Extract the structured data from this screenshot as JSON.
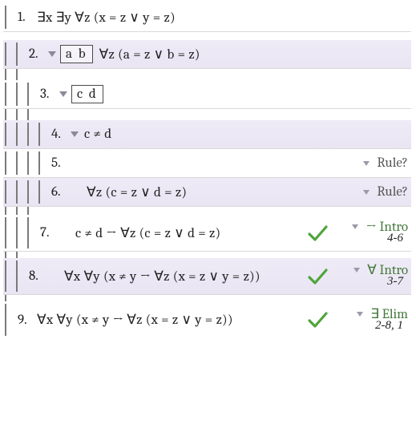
{
  "lines": {
    "l1": {
      "num": "1.",
      "formula": "∃x ∃y ∀z (x = z ∨ y = z)"
    },
    "l2": {
      "num": "2.",
      "flag": "a b",
      "formula": "∀z (a = z ∨ b = z)"
    },
    "l3": {
      "num": "3.",
      "flag": "c d",
      "formula": ""
    },
    "l4": {
      "num": "4.",
      "formula": "c ≠ d"
    },
    "l5": {
      "num": "5.",
      "formula": "",
      "rule": "Rule?"
    },
    "l6": {
      "num": "6.",
      "formula": "∀z (c = z ∨ d = z)",
      "rule": "Rule?"
    },
    "l7": {
      "num": "7.",
      "formula": "c ≠ d → ∀z (c = z ∨ d = z)",
      "rule": "→ Intro",
      "cite": "4-6"
    },
    "l8": {
      "num": "8.",
      "formula": "∀x ∀y (x ≠ y → ∀z (x = z ∨ y = z))",
      "rule": "∀ Intro",
      "cite": "3-7"
    },
    "l9": {
      "num": "9.",
      "formula": "∀x ∀y (x ≠ y → ∀z (x = z ∨ y = z))",
      "rule": "∃ Elim",
      "cite": "2-8, 1"
    }
  }
}
